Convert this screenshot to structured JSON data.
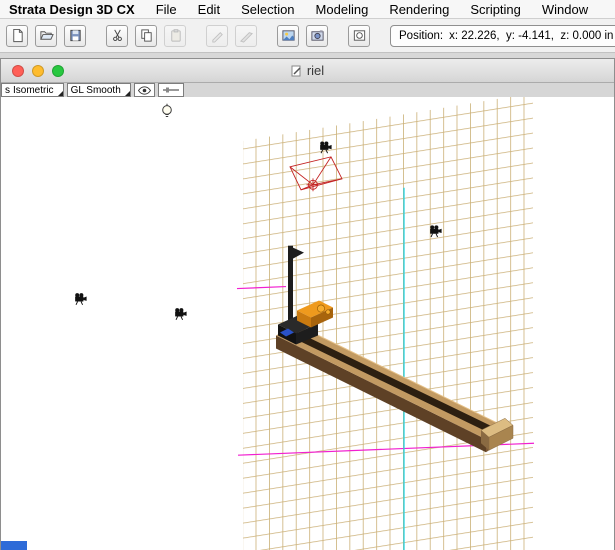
{
  "menu": {
    "app_name": "Strata Design 3D CX",
    "items": [
      "File",
      "Edit",
      "Selection",
      "Modeling",
      "Rendering",
      "Scripting",
      "Window"
    ]
  },
  "toolbar": {
    "position_label": "Position:",
    "position_value": "x: 22.226,  y: -4.141,  z: 0.000 in",
    "buttons": [
      "new-document",
      "open",
      "save",
      "cut",
      "copy",
      "paste",
      "pen-tool",
      "marker-tool",
      "render",
      "render-preview",
      "snapshot"
    ]
  },
  "window": {
    "title": "riel",
    "traffic_lights": [
      "close",
      "minimize",
      "zoom"
    ]
  },
  "controls": {
    "view_prefix": "s",
    "view_mode": "Isometric",
    "shading": "GL Smooth"
  },
  "scene": {
    "objects": [
      "camera-frustum",
      "camera",
      "camera",
      "camera",
      "camera",
      "point-light",
      "launcher-model"
    ],
    "colors": {
      "grid": "#cbb077",
      "guide_magenta": "#f11fd0",
      "guide_cyan": "#25d4e6",
      "frustum": "#c32222",
      "model_wood": "#c29a62",
      "model_accent": "#ef9a1d"
    }
  }
}
